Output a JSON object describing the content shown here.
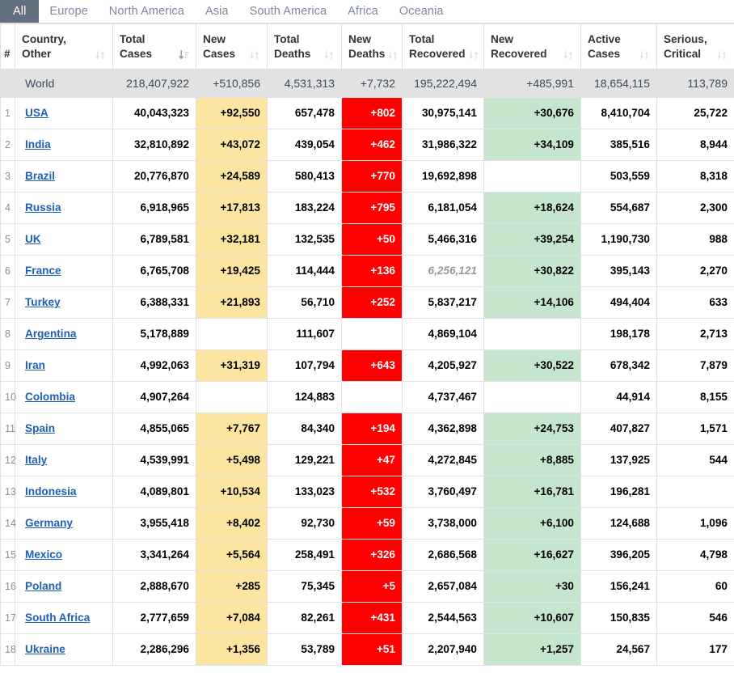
{
  "tabs": [
    {
      "label": "All",
      "active": true
    },
    {
      "label": "Europe",
      "active": false
    },
    {
      "label": "North America",
      "active": false
    },
    {
      "label": "Asia",
      "active": false
    },
    {
      "label": "South America",
      "active": false
    },
    {
      "label": "Africa",
      "active": false
    },
    {
      "label": "Oceania",
      "active": false
    }
  ],
  "columns": [
    {
      "key": "num",
      "line1": "#",
      "line2": "",
      "sort": "none"
    },
    {
      "key": "country",
      "line1": "Country,",
      "line2": "Other",
      "sort": "both"
    },
    {
      "key": "total_cases",
      "line1": "Total",
      "line2": "Cases",
      "sort": "desc"
    },
    {
      "key": "new_cases",
      "line1": "New",
      "line2": "Cases",
      "sort": "both"
    },
    {
      "key": "total_deaths",
      "line1": "Total",
      "line2": "Deaths",
      "sort": "both"
    },
    {
      "key": "new_deaths",
      "line1": "New",
      "line2": "Deaths",
      "sort": "both"
    },
    {
      "key": "total_recov",
      "line1": "Total",
      "line2": "Recovered",
      "sort": "both"
    },
    {
      "key": "new_recov",
      "line1": "New",
      "line2": "Recovered",
      "sort": "both"
    },
    {
      "key": "active_cases",
      "line1": "Active",
      "line2": "Cases",
      "sort": "both"
    },
    {
      "key": "serious",
      "line1": "Serious,",
      "line2": "Critical",
      "sort": "both"
    }
  ],
  "world_row": {
    "num": "",
    "country": "World",
    "total_cases": "218,407,922",
    "new_cases": "+510,856",
    "total_deaths": "4,531,313",
    "new_deaths": "+7,732",
    "total_recov": "195,222,494",
    "new_recov": "+485,991",
    "active_cases": "18,654,115",
    "serious": "113,789"
  },
  "rows": [
    {
      "num": "1",
      "country": "USA",
      "total_cases": "40,043,323",
      "new_cases": "+92,550",
      "total_deaths": "657,478",
      "new_deaths": "+802",
      "total_recov": "30,975,141",
      "new_recov": "+30,676",
      "active_cases": "8,410,704",
      "serious": "25,722"
    },
    {
      "num": "2",
      "country": "India",
      "total_cases": "32,810,892",
      "new_cases": "+43,072",
      "total_deaths": "439,054",
      "new_deaths": "+462",
      "total_recov": "31,986,322",
      "new_recov": "+34,109",
      "active_cases": "385,516",
      "serious": "8,944"
    },
    {
      "num": "3",
      "country": "Brazil",
      "total_cases": "20,776,870",
      "new_cases": "+24,589",
      "total_deaths": "580,413",
      "new_deaths": "+770",
      "total_recov": "19,692,898",
      "new_recov": "",
      "active_cases": "503,559",
      "serious": "8,318"
    },
    {
      "num": "4",
      "country": "Russia",
      "total_cases": "6,918,965",
      "new_cases": "+17,813",
      "total_deaths": "183,224",
      "new_deaths": "+795",
      "total_recov": "6,181,054",
      "new_recov": "+18,624",
      "active_cases": "554,687",
      "serious": "2,300"
    },
    {
      "num": "5",
      "country": "UK",
      "total_cases": "6,789,581",
      "new_cases": "+32,181",
      "total_deaths": "132,535",
      "new_deaths": "+50",
      "total_recov": "5,466,316",
      "new_recov": "+39,254",
      "active_cases": "1,190,730",
      "serious": "988"
    },
    {
      "num": "6",
      "country": "France",
      "total_cases": "6,765,708",
      "new_cases": "+19,425",
      "total_deaths": "114,444",
      "new_deaths": "+136",
      "total_recov": "6,256,121",
      "new_recov": "+30,822",
      "active_cases": "395,143",
      "serious": "2,270",
      "total_recov_italic": true
    },
    {
      "num": "7",
      "country": "Turkey",
      "total_cases": "6,388,331",
      "new_cases": "+21,893",
      "total_deaths": "56,710",
      "new_deaths": "+252",
      "total_recov": "5,837,217",
      "new_recov": "+14,106",
      "active_cases": "494,404",
      "serious": "633"
    },
    {
      "num": "8",
      "country": "Argentina",
      "total_cases": "5,178,889",
      "new_cases": "",
      "total_deaths": "111,607",
      "new_deaths": "",
      "total_recov": "4,869,104",
      "new_recov": "",
      "active_cases": "198,178",
      "serious": "2,713"
    },
    {
      "num": "9",
      "country": "Iran",
      "total_cases": "4,992,063",
      "new_cases": "+31,319",
      "total_deaths": "107,794",
      "new_deaths": "+643",
      "total_recov": "4,205,927",
      "new_recov": "+30,522",
      "active_cases": "678,342",
      "serious": "7,879"
    },
    {
      "num": "10",
      "country": "Colombia",
      "total_cases": "4,907,264",
      "new_cases": "",
      "total_deaths": "124,883",
      "new_deaths": "",
      "total_recov": "4,737,467",
      "new_recov": "",
      "active_cases": "44,914",
      "serious": "8,155"
    },
    {
      "num": "11",
      "country": "Spain",
      "total_cases": "4,855,065",
      "new_cases": "+7,767",
      "total_deaths": "84,340",
      "new_deaths": "+194",
      "total_recov": "4,362,898",
      "new_recov": "+24,753",
      "active_cases": "407,827",
      "serious": "1,571"
    },
    {
      "num": "12",
      "country": "Italy",
      "total_cases": "4,539,991",
      "new_cases": "+5,498",
      "total_deaths": "129,221",
      "new_deaths": "+47",
      "total_recov": "4,272,845",
      "new_recov": "+8,885",
      "active_cases": "137,925",
      "serious": "544"
    },
    {
      "num": "13",
      "country": "Indonesia",
      "total_cases": "4,089,801",
      "new_cases": "+10,534",
      "total_deaths": "133,023",
      "new_deaths": "+532",
      "total_recov": "3,760,497",
      "new_recov": "+16,781",
      "active_cases": "196,281",
      "serious": ""
    },
    {
      "num": "14",
      "country": "Germany",
      "total_cases": "3,955,418",
      "new_cases": "+8,402",
      "total_deaths": "92,730",
      "new_deaths": "+59",
      "total_recov": "3,738,000",
      "new_recov": "+6,100",
      "active_cases": "124,688",
      "serious": "1,096"
    },
    {
      "num": "15",
      "country": "Mexico",
      "total_cases": "3,341,264",
      "new_cases": "+5,564",
      "total_deaths": "258,491",
      "new_deaths": "+326",
      "total_recov": "2,686,568",
      "new_recov": "+16,627",
      "active_cases": "396,205",
      "serious": "4,798"
    },
    {
      "num": "16",
      "country": "Poland",
      "total_cases": "2,888,670",
      "new_cases": "+285",
      "total_deaths": "75,345",
      "new_deaths": "+5",
      "total_recov": "2,657,084",
      "new_recov": "+30",
      "active_cases": "156,241",
      "serious": "60"
    },
    {
      "num": "17",
      "country": "South Africa",
      "total_cases": "2,777,659",
      "new_cases": "+7,084",
      "total_deaths": "82,261",
      "new_deaths": "+431",
      "total_recov": "2,544,563",
      "new_recov": "+10,607",
      "active_cases": "150,835",
      "serious": "546"
    },
    {
      "num": "18",
      "country": "Ukraine",
      "total_cases": "2,286,296",
      "new_cases": "+1,356",
      "total_deaths": "53,789",
      "new_deaths": "+51",
      "total_recov": "2,207,940",
      "new_recov": "+1,257",
      "active_cases": "24,567",
      "serious": "177"
    }
  ],
  "colors": {
    "new_cases_bg": "#fbe5a1",
    "new_deaths_bg": "#ff0000",
    "new_recovered_bg": "#c6e5cd",
    "world_row_bg": "#e2e2e2",
    "active_tab_bg": "#63707e",
    "link": "#1d60b5"
  }
}
